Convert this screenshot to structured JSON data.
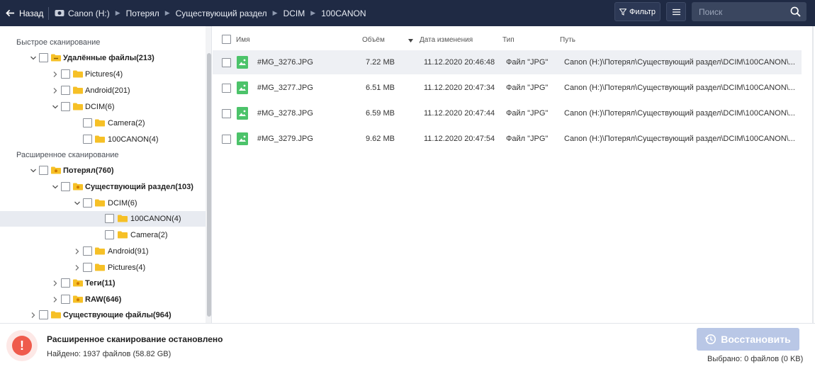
{
  "topbar": {
    "back_label": "Назад",
    "breadcrumbs": [
      "Canon (H:)",
      "Потерял",
      "Существующий раздел",
      "DCIM",
      "100CANON"
    ],
    "filter_label": "Фильтр",
    "search_placeholder": "Поиск"
  },
  "tree": {
    "quick_scan_label": "Быстрое сканирование",
    "advanced_scan_label": "Расширенное сканирование",
    "quick_items": [
      {
        "label": "Удалённые файлы(213)",
        "bold": true,
        "expanded": true
      },
      {
        "label": "Pictures(4)",
        "bold": false,
        "expanded": false
      },
      {
        "label": "Android(201)",
        "bold": false,
        "expanded": false
      },
      {
        "label": "DCIM(6)",
        "bold": false,
        "expanded": true
      },
      {
        "label": "Camera(2)",
        "bold": false
      },
      {
        "label": "100CANON(4)",
        "bold": false
      }
    ],
    "advanced_items": [
      {
        "label": "Потерял(760)",
        "bold": true,
        "expanded": true
      },
      {
        "label": "Существующий раздел(103)",
        "bold": true,
        "expanded": true
      },
      {
        "label": "DCIM(6)",
        "bold": false,
        "expanded": true
      },
      {
        "label": "100CANON(4)",
        "bold": false,
        "selected": true
      },
      {
        "label": "Camera(2)",
        "bold": false
      },
      {
        "label": "Android(91)",
        "bold": false,
        "expanded": false
      },
      {
        "label": "Pictures(4)",
        "bold": false,
        "expanded": false
      },
      {
        "label": "Теги(11)",
        "bold": true,
        "expanded": false
      },
      {
        "label": "RAW(646)",
        "bold": true,
        "expanded": false
      },
      {
        "label": "Существующие файлы(964)",
        "bold": true,
        "expanded": false
      }
    ]
  },
  "list": {
    "headers": {
      "name": "Имя",
      "size": "Объём",
      "date": "Дата изменения",
      "type": "Тип",
      "path": "Путь"
    },
    "rows": [
      {
        "name": "#MG_3276.JPG",
        "size": "7.22 MB",
        "date": "11.12.2020 20:46:48",
        "type": "Файл \"JPG\"",
        "path": "Canon (H:)\\Потерял\\Существующий раздел\\DCIM\\100CANON\\..."
      },
      {
        "name": "#MG_3277.JPG",
        "size": "6.51 MB",
        "date": "11.12.2020 20:47:34",
        "type": "Файл \"JPG\"",
        "path": "Canon (H:)\\Потерял\\Существующий раздел\\DCIM\\100CANON\\..."
      },
      {
        "name": "#MG_3278.JPG",
        "size": "6.59 MB",
        "date": "11.12.2020 20:47:44",
        "type": "Файл \"JPG\"",
        "path": "Canon (H:)\\Потерял\\Существующий раздел\\DCIM\\100CANON\\..."
      },
      {
        "name": "#MG_3279.JPG",
        "size": "9.62 MB",
        "date": "11.12.2020 20:47:54",
        "type": "Файл \"JPG\"",
        "path": "Canon (H:)\\Потерял\\Существующий раздел\\DCIM\\100CANON\\..."
      }
    ]
  },
  "status": {
    "title": "Расширенное сканирование остановлено",
    "found": "Найдено: 1937 файлов (58.82 GB)",
    "recover_label": "Восстановить",
    "selected": "Выбрано: 0 файлов  (0 KB)"
  },
  "colors": {
    "topbar": "#1f2a44",
    "folder": "#f6c026",
    "image_icon": "#4cc36a",
    "stop": "#ef5b4c",
    "recover_disabled": "#b9c7e6"
  }
}
